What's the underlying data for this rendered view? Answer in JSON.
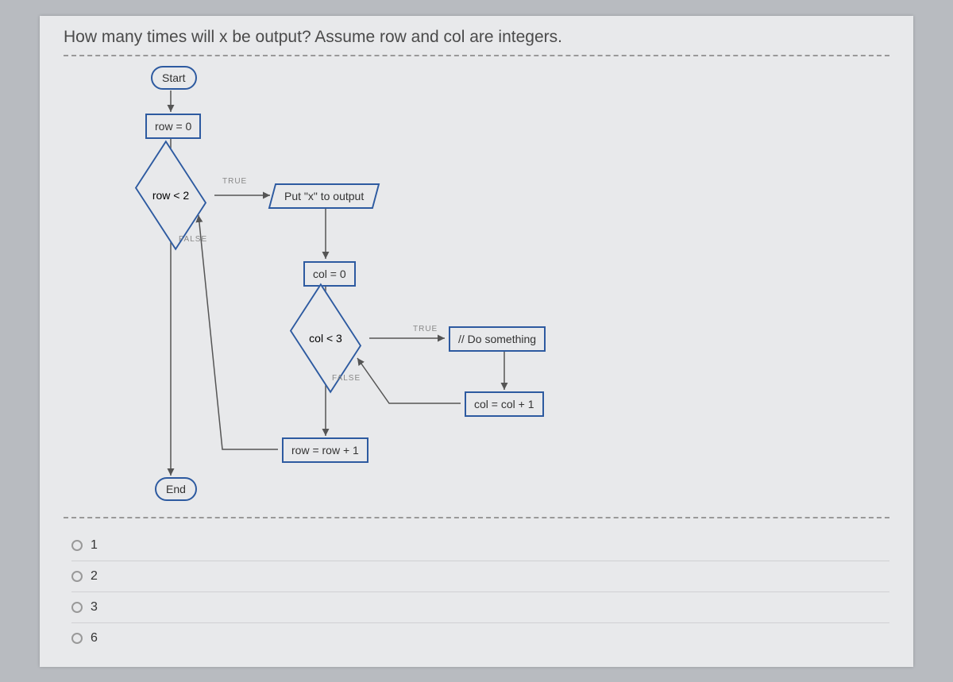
{
  "question": "How many times will x be output? Assume row and col are integers.",
  "flowchart": {
    "start": "Start",
    "end": "End",
    "row_init": "row = 0",
    "row_cond": "row < 2",
    "output": "Put \"x\" to output",
    "col_init": "col = 0",
    "col_cond": "col < 3",
    "do_something": "// Do something",
    "col_inc": "col = col + 1",
    "row_inc": "row = row + 1",
    "label_true": "TRUE",
    "label_false": "FALSE",
    "label_true2": "TRUE",
    "label_false2": "FALSE"
  },
  "answers": {
    "opt1": "1",
    "opt2": "2",
    "opt3": "3",
    "opt4": "6"
  }
}
